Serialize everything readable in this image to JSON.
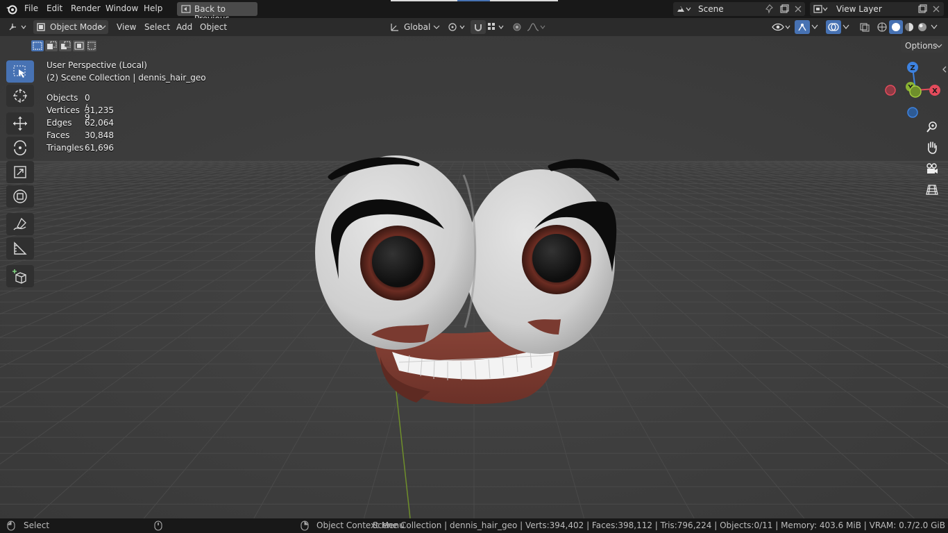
{
  "topbar": {
    "menus": [
      "File",
      "Edit",
      "Render",
      "Window",
      "Help"
    ],
    "back_button": "Back to Previous",
    "scene_name": "Scene",
    "view_layer": "View Layer"
  },
  "header": {
    "mode": "Object Mode",
    "menus": [
      "View",
      "Select",
      "Add",
      "Object"
    ],
    "transform_orientation": "Global",
    "options_label": "Options"
  },
  "viewport": {
    "perspective_label": "User Perspective (Local)",
    "collection_label": "(2) Scene Collection | dennis_hair_geo",
    "stats": [
      {
        "label": "Objects",
        "value": "0 / 9"
      },
      {
        "label": "Vertices",
        "value": "31,235"
      },
      {
        "label": "Edges",
        "value": "62,064"
      },
      {
        "label": "Faces",
        "value": "30,848"
      },
      {
        "label": "Triangles",
        "value": "61,696"
      }
    ],
    "gizmo": {
      "z": "Z",
      "y": "Y",
      "x": "X"
    }
  },
  "toolbar": {
    "tools": [
      "select-box-tool",
      "cursor-tool",
      "move-tool",
      "rotate-tool",
      "scale-tool",
      "transform-tool",
      "annotate-tool",
      "measure-tool",
      "add-cube-tool"
    ]
  },
  "statusbar": {
    "left_action": "Select",
    "middle_action": "Object Context Menu",
    "info": "Scene Collection | dennis_hair_geo | Verts:394,402 | Faces:398,112 | Tris:796,224 | Objects:0/11 | Memory: 403.6 MiB | VRAM: 0.7/2.0 GiB"
  },
  "colors": {
    "active_blue": "#4772b3",
    "viewport_bg": "#3d3d3d",
    "axis_x": "#e44b5c",
    "axis_y": "#8ab333",
    "axis_z": "#3d82e0"
  }
}
